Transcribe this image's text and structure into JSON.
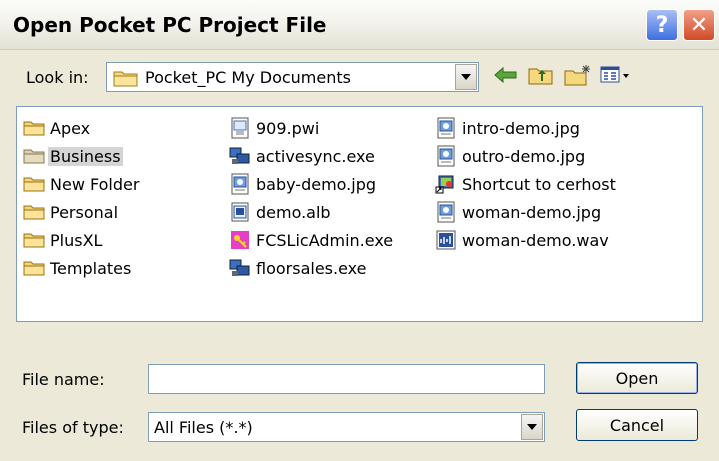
{
  "window": {
    "title": "Open Pocket PC Project File",
    "help_icon": "?",
    "close_icon": "✕"
  },
  "toolbar": {
    "look_in_label": "Look in:",
    "look_in_value": "Pocket_PC My Documents",
    "icons": [
      "back-arrow-icon",
      "up-folder-icon",
      "new-folder-icon",
      "view-menu-icon"
    ]
  },
  "files": {
    "column1": [
      {
        "name": "Apex",
        "icon": "folder-icon"
      },
      {
        "name": "Business",
        "icon": "folder-icon",
        "selected": true
      },
      {
        "name": "New Folder",
        "icon": "folder-icon"
      },
      {
        "name": "Personal",
        "icon": "folder-icon"
      },
      {
        "name": "PlusXL",
        "icon": "folder-icon"
      },
      {
        "name": "Templates",
        "icon": "folder-icon"
      }
    ],
    "column2": [
      {
        "name": "909.pwi",
        "icon": "pwi-file-icon"
      },
      {
        "name": "activesync.exe",
        "icon": "exe-icon"
      },
      {
        "name": "baby-demo.jpg",
        "icon": "image-file-icon"
      },
      {
        "name": "demo.alb",
        "icon": "alb-file-icon"
      },
      {
        "name": "FCSLicAdmin.exe",
        "icon": "key-exe-icon"
      },
      {
        "name": "floorsales.exe",
        "icon": "exe-icon"
      }
    ],
    "column3": [
      {
        "name": "intro-demo.jpg",
        "icon": "image-file-icon"
      },
      {
        "name": "outro-demo.jpg",
        "icon": "image-file-icon"
      },
      {
        "name": "Shortcut to cerhost",
        "icon": "shortcut-icon"
      },
      {
        "name": "woman-demo.jpg",
        "icon": "image-file-icon"
      },
      {
        "name": "woman-demo.wav",
        "icon": "sound-file-icon"
      }
    ]
  },
  "form": {
    "file_name_label": "File name:",
    "file_name_value": "",
    "files_of_type_label": "Files of type:",
    "files_of_type_value": "All Files (*.*)",
    "open_label": "Open",
    "cancel_label": "Cancel"
  }
}
